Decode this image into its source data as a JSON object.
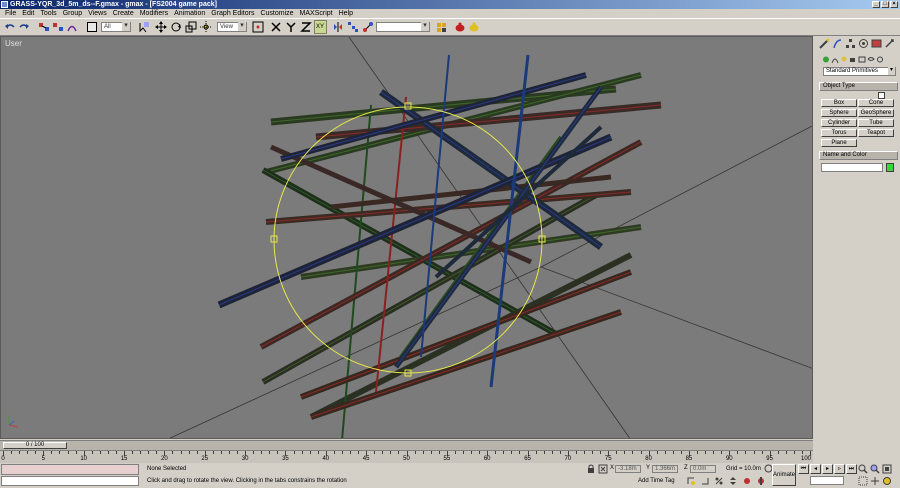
{
  "window": {
    "title": "GRASS-YQR_3d_5m_ds--F.gmax - gmax - [FS2004 game pack]",
    "buttons": [
      "_",
      "□",
      "×"
    ]
  },
  "menu": [
    "File",
    "Edit",
    "Tools",
    "Group",
    "Views",
    "Create",
    "Modifiers",
    "Animation",
    "Graph Editors",
    "Customize",
    "MAXScript",
    "Help"
  ],
  "toolbar": {
    "selection_filter": "All",
    "coord_system": "View",
    "named_selection": ""
  },
  "viewport": {
    "label": "User"
  },
  "command_panel": {
    "category": "Standard Primitives",
    "object_type_title": "Object Type",
    "name_color_title": "Name and Color",
    "object_buttons": [
      "Box",
      "Cone",
      "Sphere",
      "GeoSphere",
      "Cylinder",
      "Tube",
      "Torus",
      "Teapot",
      "Plane"
    ],
    "swatch_color": "#3fd23f"
  },
  "timeline": {
    "slider_label": "0 / 100",
    "ticks": [
      "0",
      "5",
      "10",
      "15",
      "20",
      "25",
      "30",
      "35",
      "40",
      "45",
      "50",
      "55",
      "60",
      "65",
      "70",
      "75",
      "80",
      "85",
      "90",
      "95",
      "100"
    ]
  },
  "status": {
    "selection": "None Selected",
    "prompt": "Click and drag to rotate the view.  Clicking in the tabs constrains the rotation",
    "x_label": "X",
    "x_value": "-3.18m",
    "y_label": "Y",
    "y_value": "1.366m",
    "z_label": "Z",
    "z_value": "0.0m",
    "grid": "Grid = 10.0m",
    "add_time_tag": "Add Time Tag",
    "animate": "Animate"
  }
}
